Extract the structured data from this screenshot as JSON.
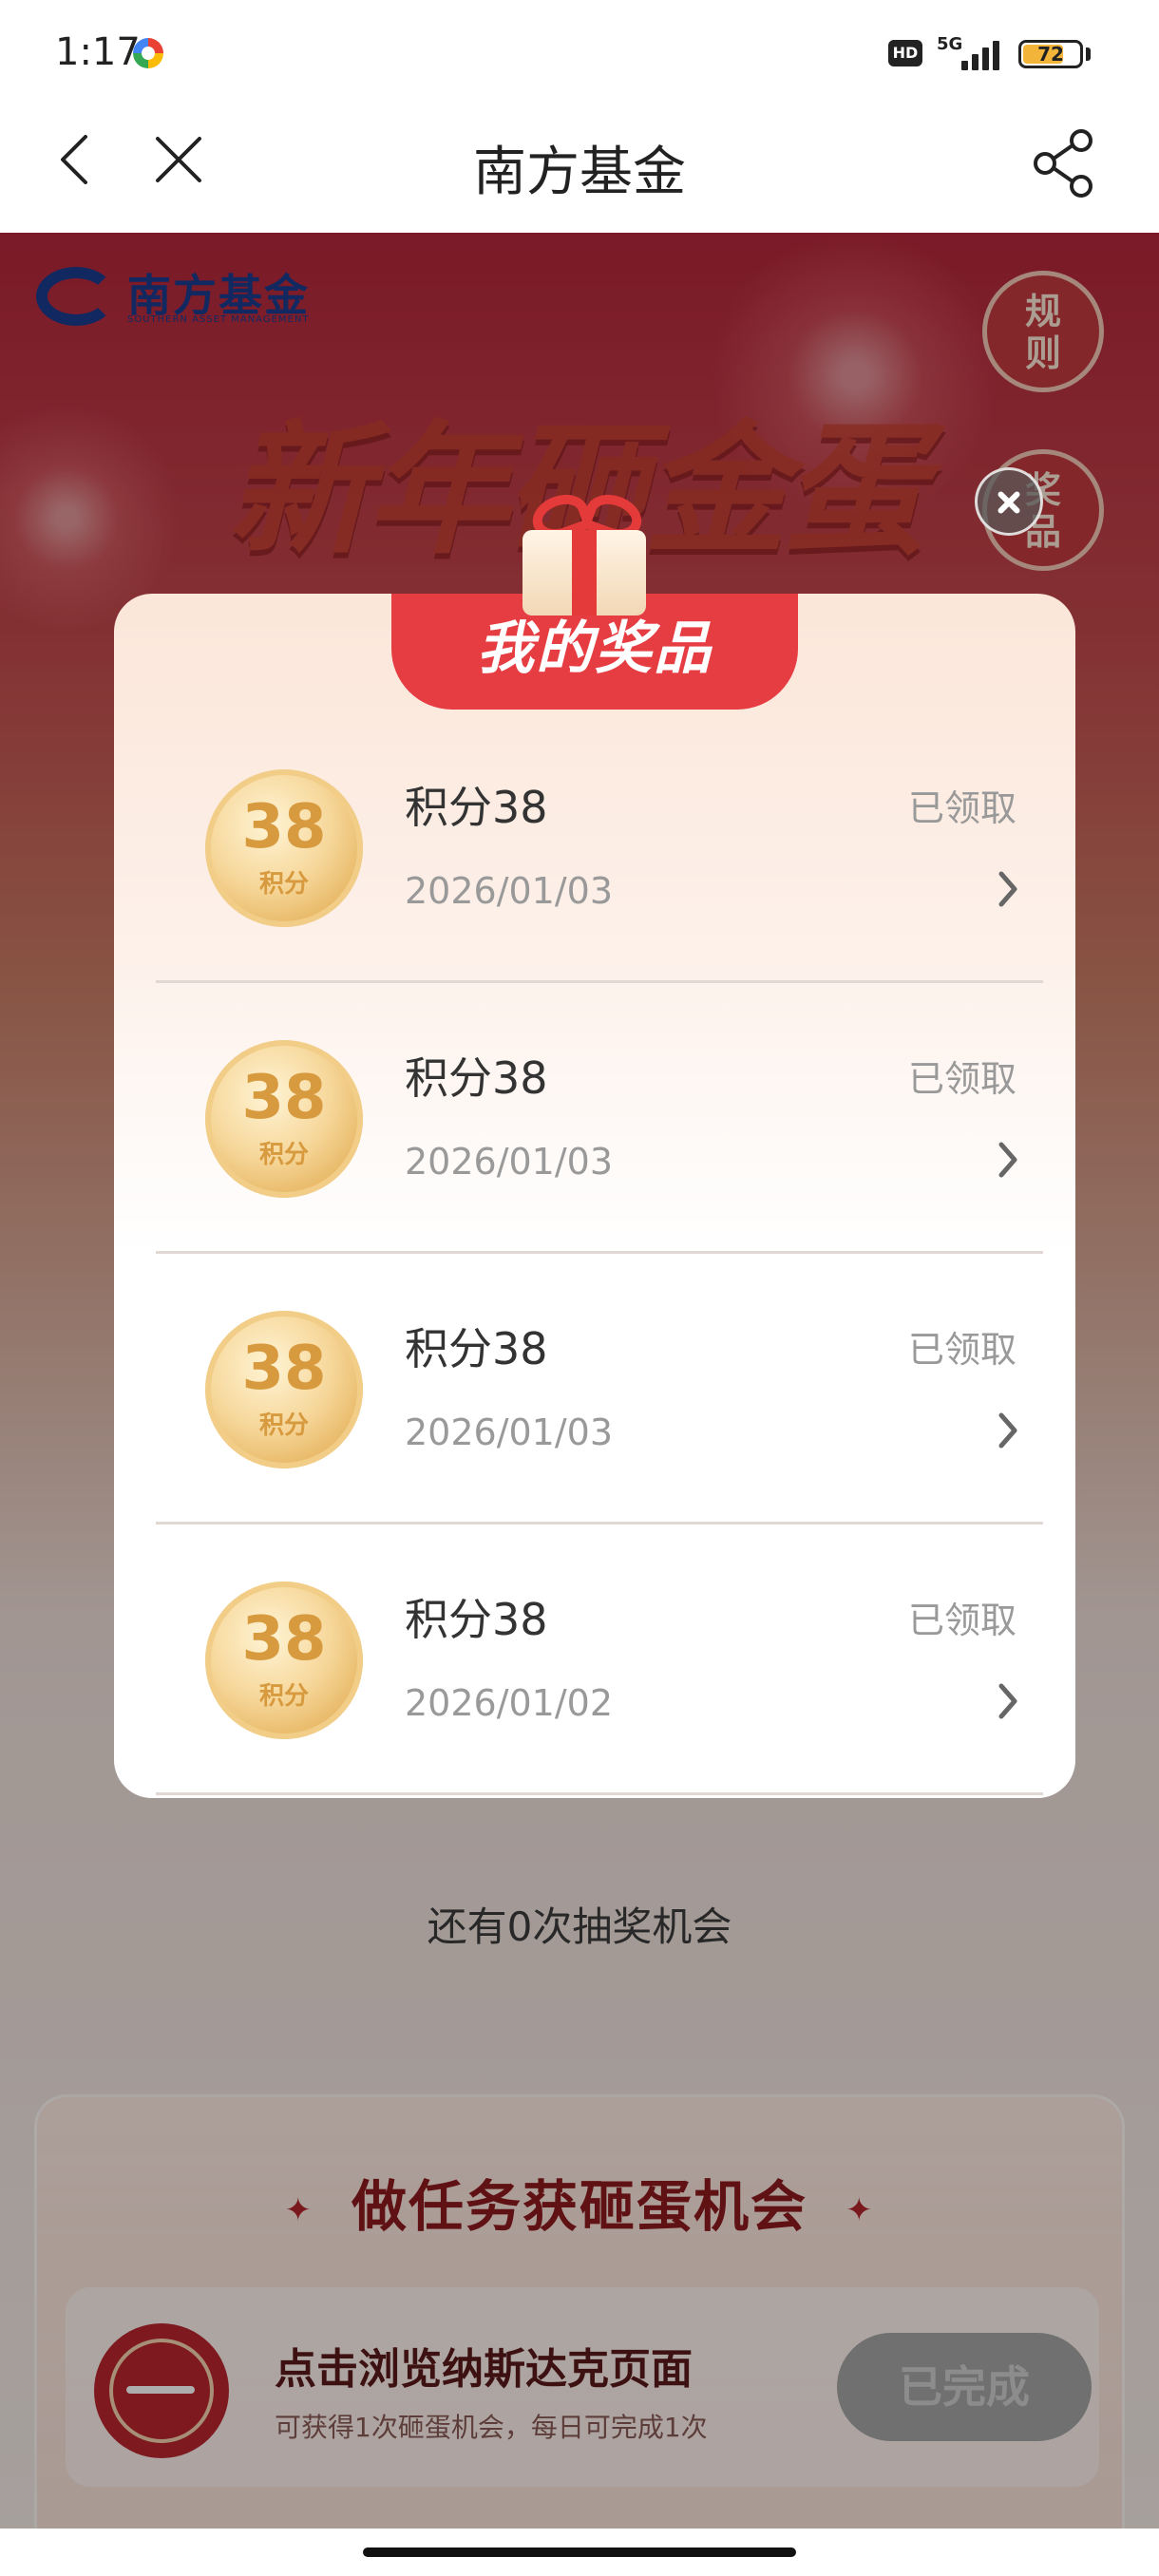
{
  "status_bar": {
    "time": "1:17",
    "network": "5G",
    "hd_label": "HD",
    "battery": "72"
  },
  "nav": {
    "title": "南方基金"
  },
  "brand": {
    "logo_text": "南方基金",
    "logo_sub": "SOUTHERN ASSET MANAGEMENT",
    "accent": "#1a3c8f"
  },
  "hero": {
    "title": "新年砸金蛋"
  },
  "side_buttons": {
    "rules": "规则",
    "prizes": "奖品"
  },
  "modal": {
    "title": "我的奖品",
    "items": [
      {
        "coin_value": "38",
        "coin_label": "积分",
        "name": "积分38",
        "status": "已领取",
        "date": "2026/01/03"
      },
      {
        "coin_value": "38",
        "coin_label": "积分",
        "name": "积分38",
        "status": "已领取",
        "date": "2026/01/03"
      },
      {
        "coin_value": "38",
        "coin_label": "积分",
        "name": "积分38",
        "status": "已领取",
        "date": "2026/01/03"
      },
      {
        "coin_value": "38",
        "coin_label": "积分",
        "name": "积分38",
        "status": "已领取",
        "date": "2026/01/02"
      }
    ]
  },
  "remaining_text": "还有0次抽奖机会",
  "tasks": {
    "header": "做任务获砸蛋机会",
    "items": [
      {
        "title": "点击浏览纳斯达克页面",
        "desc": "可获得1次砸蛋机会，每日可完成1次",
        "button": "已完成"
      }
    ]
  },
  "colors": {
    "modal_tab": "#e63d43",
    "primary_red": "#b5263b"
  }
}
